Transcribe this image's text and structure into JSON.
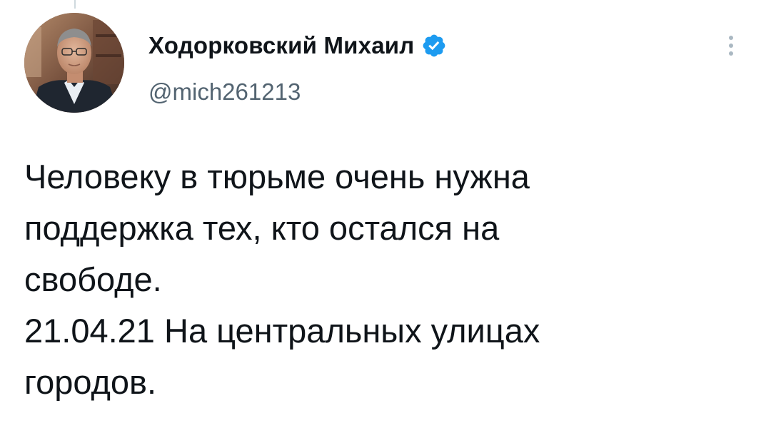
{
  "author": {
    "display_name": "Ходорковский Михаил",
    "handle": "@mich261213",
    "verified": true,
    "verified_color": "#1d9bf0"
  },
  "tweet": {
    "lines": [
      "Человеку в тюрьме очень нужна",
      "поддержка тех, кто остался на",
      "свободе.",
      "21.04.21 На центральных улицах",
      "городов."
    ]
  },
  "icons": {
    "verified": "verified-badge-icon",
    "more": "more-options-icon",
    "avatar": "profile-photo"
  }
}
